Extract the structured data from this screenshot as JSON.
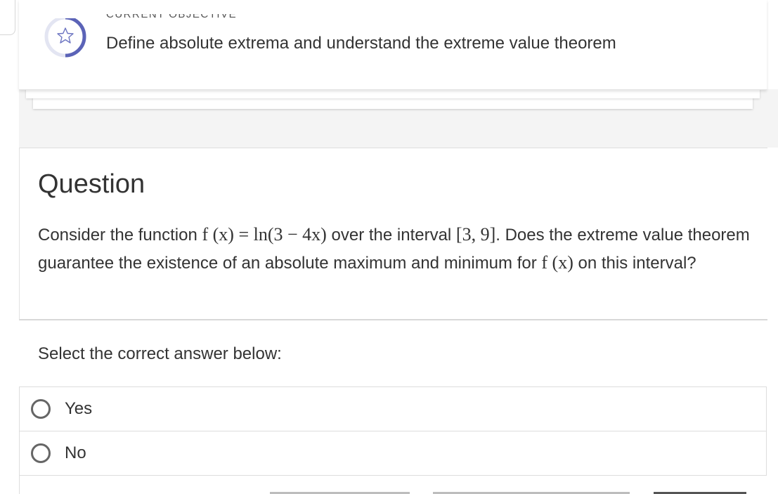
{
  "objective": {
    "label": "CURRENT OBJECTIVE",
    "title": "Define absolute extrema and understand the extreme value theorem",
    "icon": "star-icon",
    "ring_color": "#5b63b7"
  },
  "question": {
    "heading": "Question",
    "text_1": "Consider the function ",
    "math_1": "f (x) = ln(3 − 4x)",
    "text_2": " over the interval ",
    "math_2": "[3, 9]",
    "text_3": ". Does the extreme value theorem guarantee the existence of an absolute maximum and minimum for ",
    "math_3": "f (x)",
    "text_4": " on this interval?"
  },
  "answers": {
    "prompt": "Select the correct answer below:",
    "options": [
      {
        "label": "Yes"
      },
      {
        "label": "No"
      }
    ]
  }
}
